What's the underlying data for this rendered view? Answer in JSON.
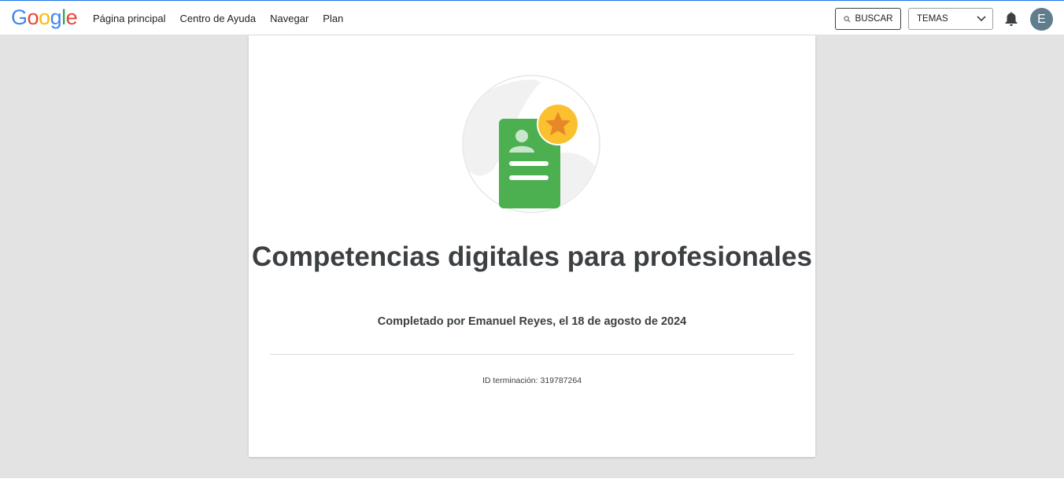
{
  "header": {
    "logo_text": "Google",
    "nav": [
      "Página principal",
      "Centro de Ayuda",
      "Navegar",
      "Plan"
    ],
    "search_label": "BUSCAR",
    "topics_label": "TEMAS",
    "avatar_initial": "E"
  },
  "certificate": {
    "title": "Competencias digitales para profesionales",
    "completed_by": "Completado por Emanuel Reyes, el 18 de agosto de 2024",
    "completion_id": "ID terminación: 319787264",
    "badge_icon": "certificate-star-icon"
  },
  "colors": {
    "badge_green": "#4caf50",
    "badge_star_bg": "#fbc02d",
    "star": "#e8862a",
    "page_bg": "#e3e3e3"
  }
}
